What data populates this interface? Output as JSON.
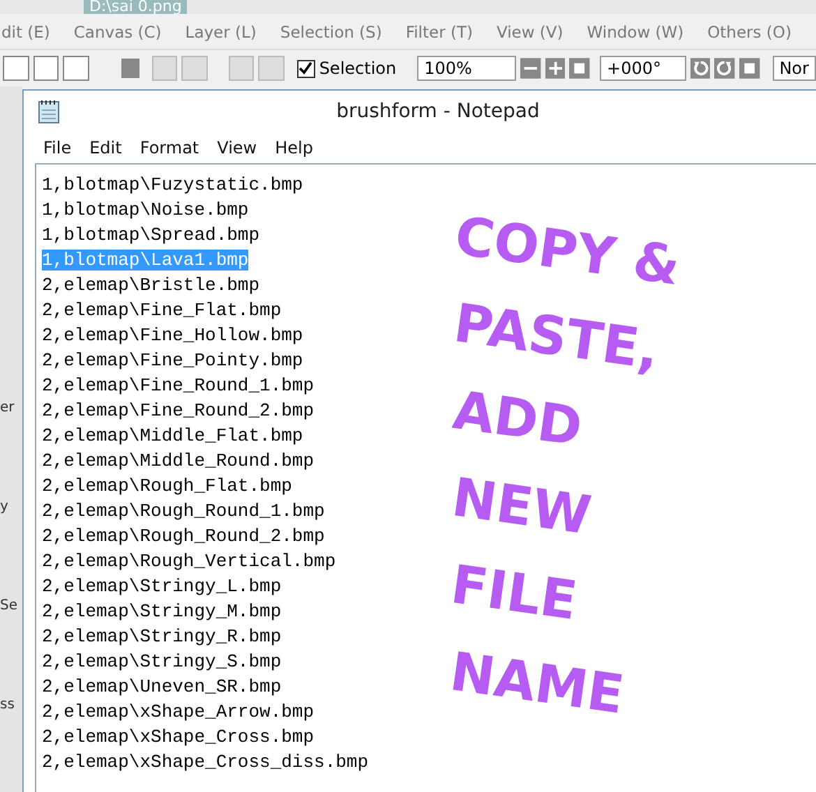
{
  "app_title": "D:\\sai 0.png",
  "app_menu": [
    "dit (E)",
    "Canvas (C)",
    "Layer (L)",
    "Selection (S)",
    "Filter (T)",
    "View (V)",
    "Window (W)",
    "Others (O)"
  ],
  "toolbar": {
    "selection_checkbox": {
      "label": "Selection",
      "checked": true
    },
    "zoom": "100%",
    "rotation": "+000°",
    "blend_mode": "Nor"
  },
  "side_fragments": [
    "er",
    "y",
    "Se",
    "ss"
  ],
  "notepad": {
    "title": "brushform - Notepad",
    "menu": [
      "File",
      "Edit",
      "Format",
      "View",
      "Help"
    ],
    "lines": [
      {
        "text": "1,blotmap\\Fuzystatic.bmp",
        "selected": false
      },
      {
        "text": "1,blotmap\\Noise.bmp",
        "selected": false
      },
      {
        "text": "1,blotmap\\Spread.bmp",
        "selected": false
      },
      {
        "text": "1,blotmap\\Lava1.bmp",
        "selected": true
      },
      {
        "text": "2,elemap\\Bristle.bmp",
        "selected": false
      },
      {
        "text": "2,elemap\\Fine_Flat.bmp",
        "selected": false
      },
      {
        "text": "2,elemap\\Fine_Hollow.bmp",
        "selected": false
      },
      {
        "text": "2,elemap\\Fine_Pointy.bmp",
        "selected": false
      },
      {
        "text": "2,elemap\\Fine_Round_1.bmp",
        "selected": false
      },
      {
        "text": "2,elemap\\Fine_Round_2.bmp",
        "selected": false
      },
      {
        "text": "2,elemap\\Middle_Flat.bmp",
        "selected": false
      },
      {
        "text": "2,elemap\\Middle_Round.bmp",
        "selected": false
      },
      {
        "text": "2,elemap\\Rough_Flat.bmp",
        "selected": false
      },
      {
        "text": "2,elemap\\Rough_Round_1.bmp",
        "selected": false
      },
      {
        "text": "2,elemap\\Rough_Round_2.bmp",
        "selected": false
      },
      {
        "text": "2,elemap\\Rough_Vertical.bmp",
        "selected": false
      },
      {
        "text": "2,elemap\\Stringy_L.bmp",
        "selected": false
      },
      {
        "text": "2,elemap\\Stringy_M.bmp",
        "selected": false
      },
      {
        "text": "2,elemap\\Stringy_R.bmp",
        "selected": false
      },
      {
        "text": "2,elemap\\Stringy_S.bmp",
        "selected": false
      },
      {
        "text": "2,elemap\\Uneven_SR.bmp",
        "selected": false
      },
      {
        "text": "2,elemap\\xShape_Arrow.bmp",
        "selected": false
      },
      {
        "text": "2,elemap\\xShape_Cross.bmp",
        "selected": false
      },
      {
        "text": "2,elemap\\xShape_Cross_diss.bmp",
        "selected": false
      }
    ]
  },
  "handwritten_note": [
    "COPY &",
    "PASTE,",
    "ADD",
    "NEW",
    "FILE",
    "NAME"
  ]
}
